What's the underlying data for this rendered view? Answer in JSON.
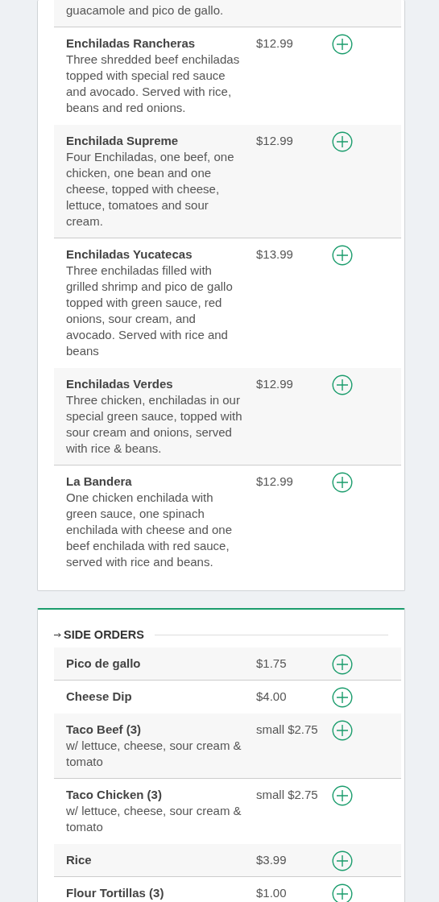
{
  "sections": [
    {
      "items": [
        {
          "description": "guacamole and pico de gallo."
        },
        {
          "name": "Enchiladas Rancheras",
          "description": "Three shredded beef enchiladas topped with special red sauce and avocado. Served with rice, beans and red onions.",
          "price": "$12.99"
        },
        {
          "name": "Enchilada Supreme",
          "description": "Four Enchiladas, one beef, one chicken, one bean and one cheese, topped with cheese, lettuce, tomatoes and sour cream.",
          "price": "$12.99"
        },
        {
          "name": "Enchiladas Yucatecas",
          "description": "Three enchiladas filled with grilled shrimp and pico de gallo topped with green sauce, red onions, sour cream, and avocado. Served with rice and beans",
          "price": "$13.99"
        },
        {
          "name": "Enchiladas Verdes",
          "description": "Three chicken, enchiladas in our special green sauce, topped with sour cream and onions, served with rice & beans.",
          "price": "$12.99"
        },
        {
          "name": "La Bandera",
          "description": "One chicken enchilada with green sauce, one spinach enchilada with cheese and one beef enchilada with red sauce, served with rice and beans.",
          "price": "$12.99"
        }
      ]
    },
    {
      "title": "SIDE ORDERS",
      "items": [
        {
          "name": "Pico de gallo",
          "price": "$1.75"
        },
        {
          "name": "Cheese Dip",
          "price": "$4.00"
        },
        {
          "name": "Taco Beef (3)",
          "description": "w/ lettuce, cheese, sour cream & tomato",
          "price": "small $2.75"
        },
        {
          "name": "Taco Chicken (3)",
          "description": "w/ lettuce, cheese, sour cream & tomato",
          "price": "small $2.75"
        },
        {
          "name": "Rice",
          "price": "$3.99"
        },
        {
          "name": "Flour Tortillas (3)",
          "price": "$1.00"
        }
      ]
    }
  ]
}
